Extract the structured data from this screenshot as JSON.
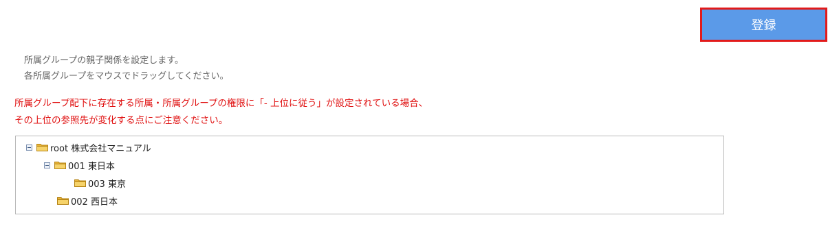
{
  "toolbar": {
    "register_label": "登録"
  },
  "description": {
    "line1": "所属グループの親子関係を設定します。",
    "line2": "各所属グループをマウスでドラッグしてください。"
  },
  "warning": {
    "line1": "所属グループ配下に存在する所属・所属グループの権限に「- 上位に従う」が設定されている場合、",
    "line2": "その上位の参照先が変化する点にご注意ください。"
  },
  "tree": {
    "root": {
      "label": "root 株式会社マニュアル",
      "expanded": true,
      "icon": "folder-icon"
    },
    "node_001": {
      "label": "001 東日本",
      "expanded": true,
      "icon": "folder-icon"
    },
    "node_003": {
      "label": "003 東京",
      "icon": "folder-icon"
    },
    "node_002": {
      "label": "002 西日本",
      "icon": "folder-icon"
    }
  },
  "colors": {
    "button_bg": "#5b9ae8",
    "button_highlight": "#e21a1a",
    "warning_text": "#e01010",
    "description_text": "#666666"
  }
}
